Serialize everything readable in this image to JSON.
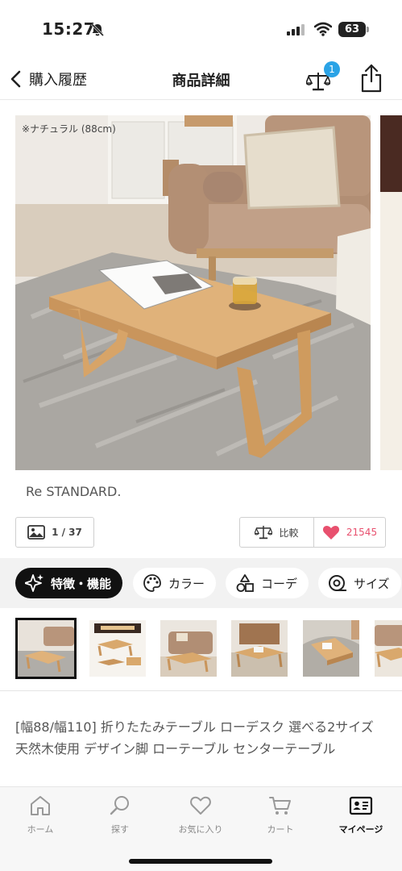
{
  "status": {
    "time": "15:27",
    "battery": "63"
  },
  "nav": {
    "back_label": "購入履歴",
    "title": "商品詳細",
    "compare_badge": "1"
  },
  "hero": {
    "caption": "※ナチュラル (88cm)"
  },
  "brand": "Re STANDARD.",
  "gallery": {
    "count": "1 / 37"
  },
  "actions": {
    "compare_label": "比較",
    "favorite_count": "21545"
  },
  "tabs": [
    {
      "label": "特徴・機能",
      "icon": "sparkle-icon",
      "active": true
    },
    {
      "label": "カラー",
      "icon": "palette-icon",
      "active": false
    },
    {
      "label": "コーデ",
      "icon": "shapes-icon",
      "active": false
    },
    {
      "label": "サイズ",
      "icon": "tape-measure-icon",
      "active": false
    }
  ],
  "product_title": "[幅88/幅110] 折りたたみテーブル ローデスク 選べる2サイズ 天然木使用 デザイン脚 ローテーブル センターテーブル",
  "tabbar": [
    {
      "label": "ホーム",
      "icon": "home-icon",
      "active": false
    },
    {
      "label": "探す",
      "icon": "search-icon",
      "active": false
    },
    {
      "label": "お気に入り",
      "icon": "heart-icon",
      "active": false
    },
    {
      "label": "カート",
      "icon": "cart-icon",
      "active": false
    },
    {
      "label": "マイページ",
      "icon": "member-card-icon",
      "active": true
    }
  ],
  "colors": {
    "accent_blue": "#2aa3e6",
    "favorite_pink": "#e8506e",
    "active_tab": "#111111"
  }
}
